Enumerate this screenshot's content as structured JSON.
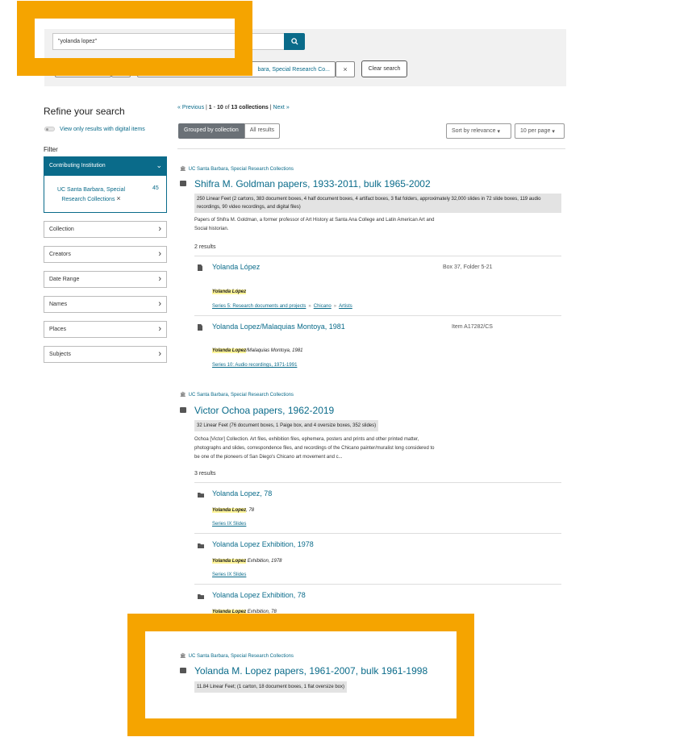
{
  "search": {
    "query": "\"yolanda lopez\"",
    "chip_institution": "bara, Special Research Co...",
    "chip_remove": "×",
    "clear_label": "Clear search"
  },
  "sidebar": {
    "refine_title": "Refine your search",
    "digital_toggle": "View only results with digital items",
    "filter_heading": "Filter",
    "open_facet": {
      "label": "Contributing Institution",
      "item": "UC Santa Barbara, Special Research Collections",
      "item_count": "45",
      "item_remove": "×"
    },
    "facets": [
      "Collection",
      "Creators",
      "Date Range",
      "Names",
      "Places",
      "Subjects"
    ]
  },
  "results_header": {
    "prev": "« Previous",
    "range_start": "1",
    "range_end": "10",
    "total": "13 collections",
    "next": "Next »",
    "grouped_label": "Grouped by collection",
    "all_label": "All results",
    "sort_label": "Sort by relevance",
    "per_page_label": "10 per page"
  },
  "collections": [
    {
      "institution": "UC Santa Barbara, Special Research Collections",
      "title": "Shifra M. Goldman papers, 1933-2011, bulk 1965-2002",
      "extent": "250 Linear Feet (2 cartons, 383 document boxes, 4 half document boxes, 4 artifact boxes, 3 flat folders, approximately 32,000 slides in 72 slide boxes, 119 audio recordings, 90 video recordings, and digital files)",
      "description": "Papers of Shifra M. Goldman, a former professor of Art History at Santa Ana College and Latin American Art and Social historian.",
      "results_count": "2 results",
      "items": [
        {
          "title": "Yolanda López",
          "location": "Box 37, Folder 5-21",
          "snippet_mark": "Yolanda López",
          "snippet_rest": "",
          "crumbs": [
            "Series 5: Research documents and projects",
            "Chicano",
            "Artists"
          ]
        },
        {
          "title": "Yolanda Lopez/Malaquias Montoya, 1981",
          "location": "Item A17282/CS",
          "snippet_mark": "Yolanda Lopez",
          "snippet_rest": "/Malaquias Montoya, 1981",
          "crumbs": [
            "Series 10: Audio recordings, 1971-1991"
          ]
        }
      ]
    },
    {
      "institution": "UC Santa Barbara, Special Research Collections",
      "title": "Victor Ochoa papers, 1962-2019",
      "extent": "32 Linear Feet (76 document boxes, 1 Paige box, and 4 oversize boxes, 352 slides)",
      "description": "Ochoa [Victor] Collection. Art files, exhibition files, ephemera, posters and prints and other printed matter, photographs and slides, correspondence files, and recordings of the Chicano painter/muralist long considered to be one of the pioneers of San Diego's Chicano art movement and c...",
      "results_count": "3 results",
      "items": [
        {
          "title": "Yolanda Lopez, 78",
          "snippet_mark": "Yolanda Lopez",
          "snippet_rest": ", 78",
          "crumbs": [
            "Series IX Slides"
          ]
        },
        {
          "title": "Yolanda Lopez Exhibition, 1978",
          "snippet_mark": "Yolanda Lopez",
          "snippet_rest": " Exhibition, 1978",
          "crumbs": [
            "Series IX Slides"
          ]
        },
        {
          "title": "Yolanda Lopez Exhibition, 78",
          "snippet_mark": "Yolanda Lopez",
          "snippet_rest": " Exhibition, 78",
          "crumbs": []
        }
      ]
    },
    {
      "institution": "UC Santa Barbara, Special Research Collections",
      "title": "Yolanda M. Lopez papers, 1961-2007, bulk 1961-1998",
      "extent": "11.84 Linear Feet; (1 carton, 18 document boxes, 1 flat oversize box)"
    }
  ],
  "colors": {
    "accent": "#0a6b8a",
    "highlight_frame": "#f5a400",
    "search_mark": "#fff59a"
  }
}
